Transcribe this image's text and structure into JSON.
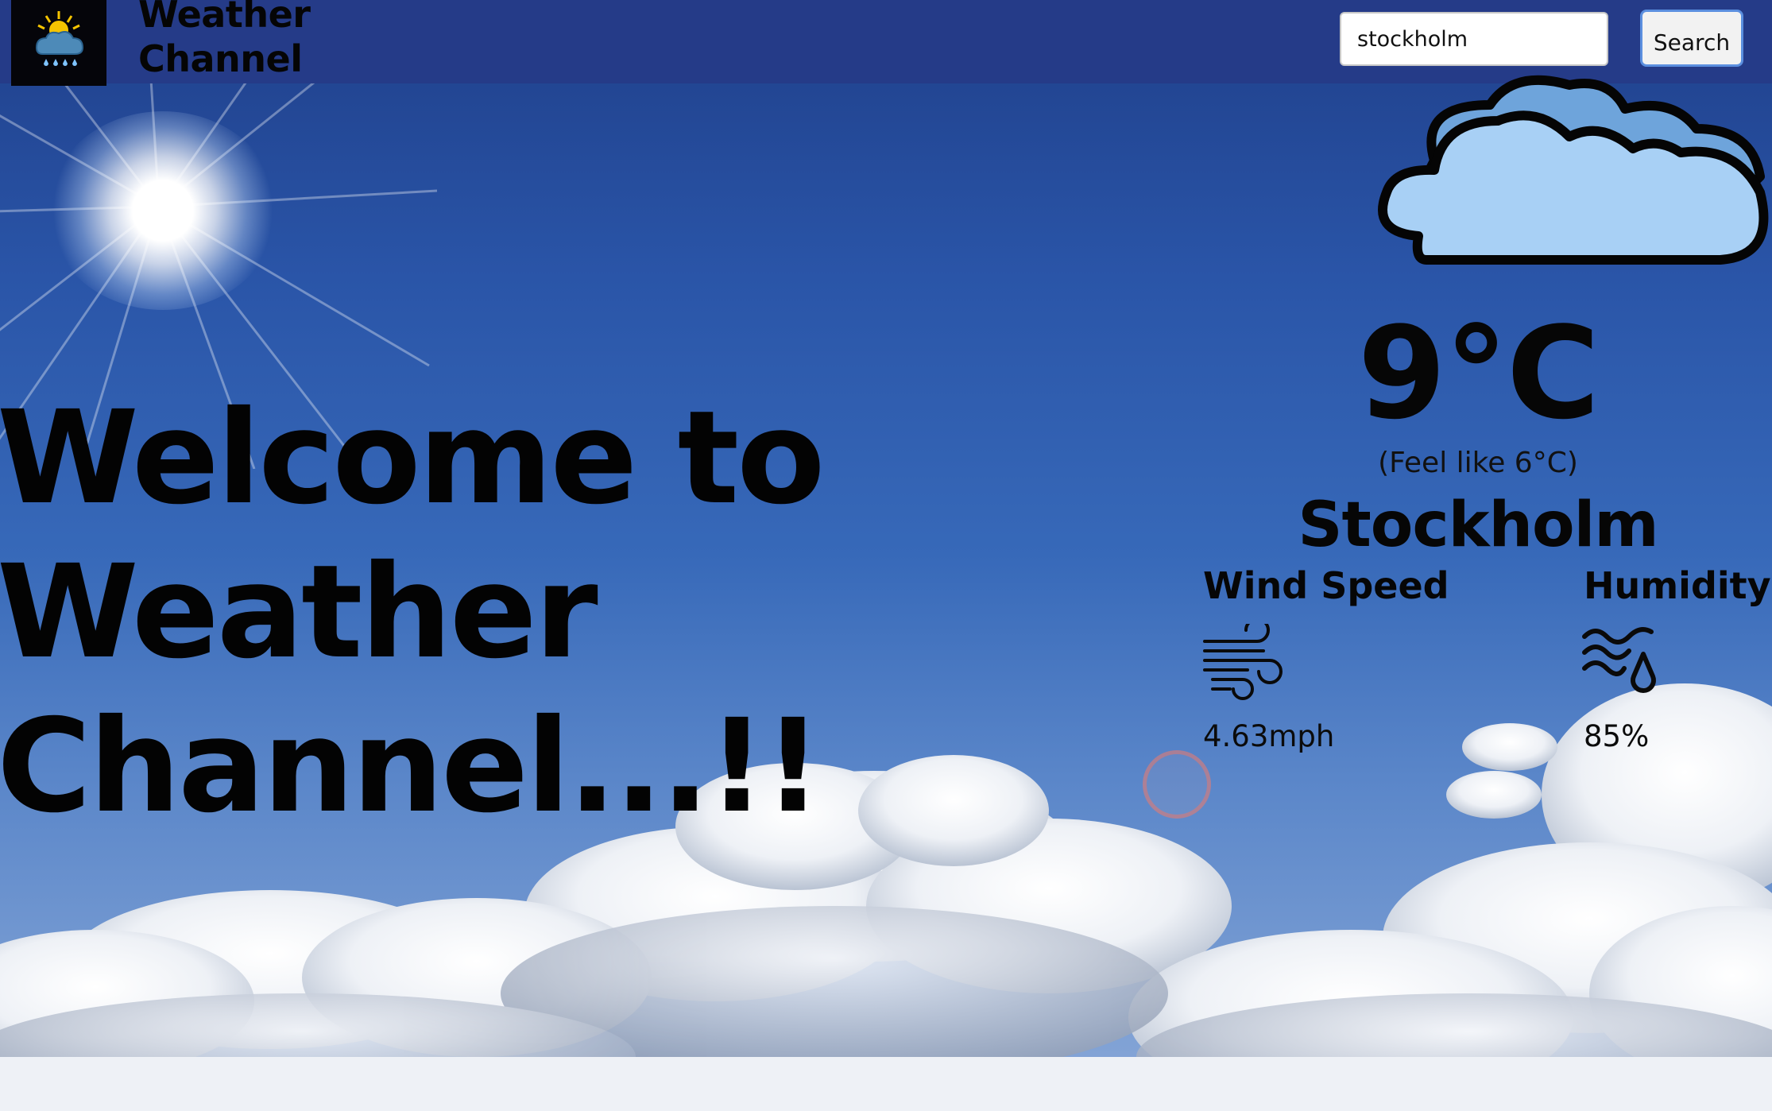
{
  "header": {
    "brand_line1": "Weather",
    "brand_line2": "Channel",
    "logo_icon": "sun-cloud-rain-icon"
  },
  "search": {
    "value": "stockholm",
    "button_label": "Search"
  },
  "welcome": {
    "line1": "Welcome to",
    "line2": "Weather",
    "line3": "Channel...!!"
  },
  "weather": {
    "condition_icon": "cloud-icon",
    "temperature": "9°C",
    "feels_like": "(Feel like 6°C)",
    "city": "Stockholm",
    "wind": {
      "label": "Wind Speed",
      "icon": "wind-icon",
      "value": "4.63mph"
    },
    "humidity": {
      "label": "Humidity",
      "icon": "humidity-icon",
      "value": "85%"
    }
  },
  "colors": {
    "header_bg": "#253b88",
    "sky": "#2a55a8",
    "cloud_fill": "#a8d0f5",
    "cloud_back": "#6ea4db",
    "text": "#060606"
  }
}
